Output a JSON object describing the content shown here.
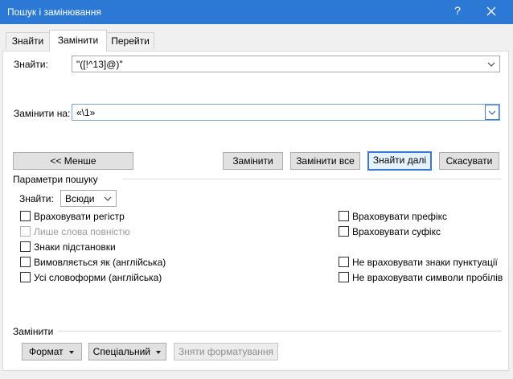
{
  "window": {
    "title": "Пошук і замінювання",
    "help_glyph": "?",
    "close_glyph": "✕"
  },
  "tabs": [
    {
      "label": "Знайти",
      "active": false
    },
    {
      "label": "Замінити",
      "active": true
    },
    {
      "label": "Перейти",
      "active": false
    }
  ],
  "find": {
    "label": "Знайти:",
    "value": "\"([!^13]@)\""
  },
  "replace": {
    "label": "Замінити на:",
    "value": "«\\1»"
  },
  "buttons": {
    "less": "<< Менше",
    "replace": "Замінити",
    "replace_all": "Замінити все",
    "find_next": "Знайти далі",
    "cancel": "Скасувати",
    "format": "Формат",
    "special": "Спеціальний",
    "no_formatting": "Зняти форматування"
  },
  "search_options": {
    "heading": "Параметри пошуку",
    "search_label": "Знайти:",
    "search_value": "Всюди",
    "left": [
      {
        "label": "Враховувати регістр",
        "checked": false,
        "disabled": false
      },
      {
        "label": "Лише слова повністю",
        "checked": false,
        "disabled": true
      },
      {
        "label": "Знаки підстановки",
        "checked": false,
        "disabled": false
      },
      {
        "label": "Вимовляється як (англійська)",
        "checked": false,
        "disabled": false
      },
      {
        "label": "Усі словоформи (англійська)",
        "checked": false,
        "disabled": false
      }
    ],
    "right": [
      {
        "label": "Враховувати префікс",
        "checked": false
      },
      {
        "label": "Враховувати суфікс",
        "checked": false
      },
      {
        "label": "Не враховувати знаки пунктуації",
        "checked": false
      },
      {
        "label": "Не враховувати символи пробілів",
        "checked": false
      }
    ]
  },
  "replace_section": {
    "heading": "Замінити"
  },
  "colors": {
    "titlebar": "#2b79d4",
    "default_button_border": "#3a78d6"
  }
}
